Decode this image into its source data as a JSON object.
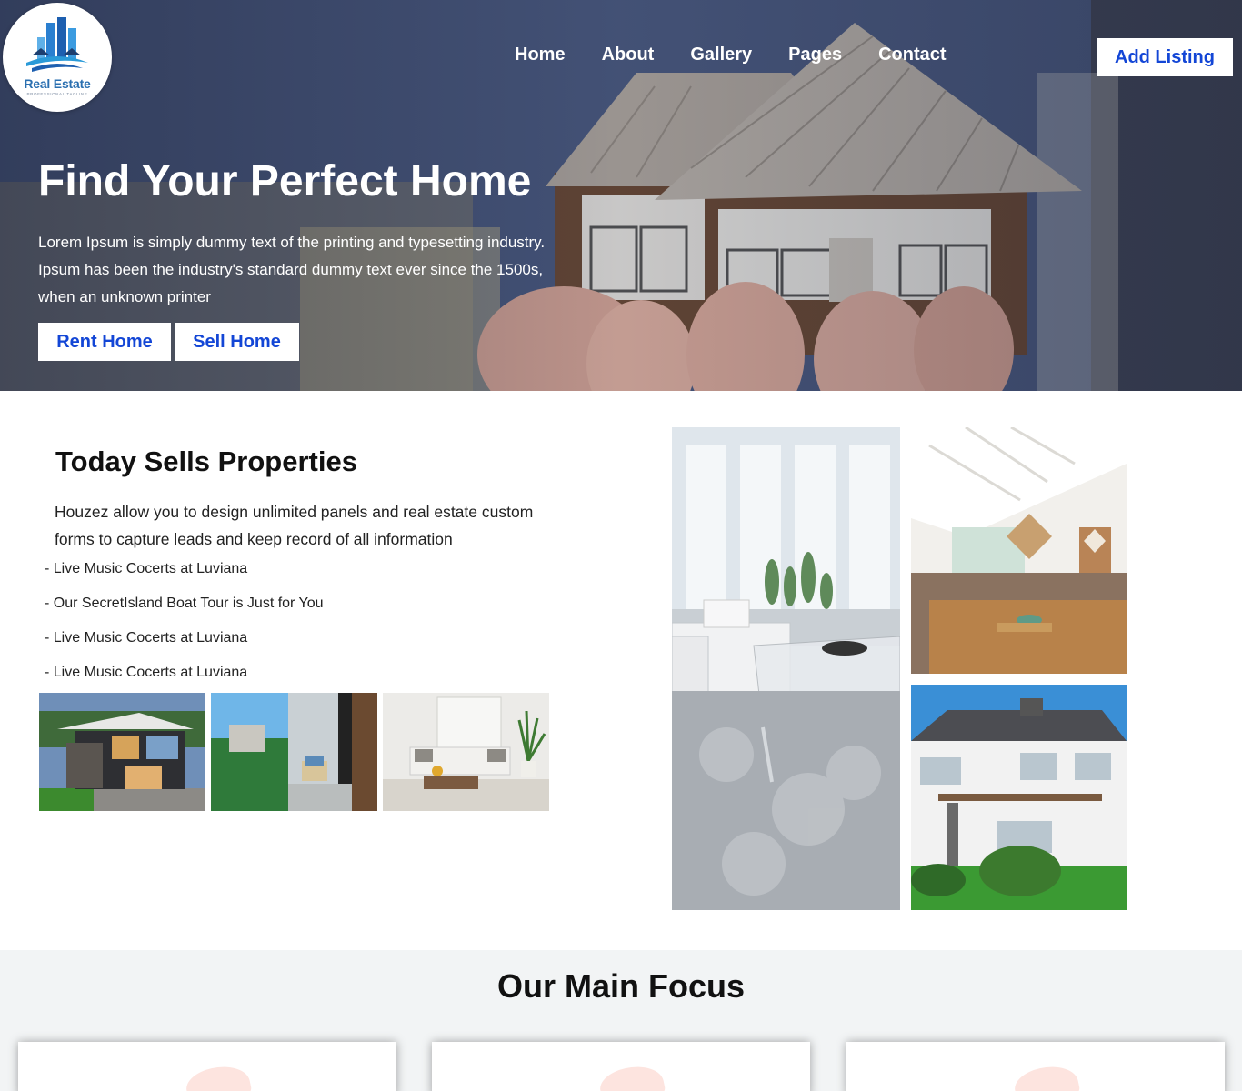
{
  "header": {
    "logo": {
      "name": "Real Estate",
      "tagline": "PROFESSIONAL TAGLINE"
    },
    "nav": [
      "Home",
      "About",
      "Gallery",
      "Pages",
      "Contact"
    ],
    "cta": "Add Listing"
  },
  "hero": {
    "title": "Find Your Perfect Home",
    "text": "Lorem Ipsum is simply dummy text of the printing and typesetting industry. Ipsum has been the industry's standard dummy text ever since the 1500s, when an unknown printer",
    "buttons": [
      "Rent Home",
      "Sell Home"
    ]
  },
  "sells": {
    "title": "Today Sells Properties",
    "description": "Houzez allow you to design unlimited panels and real estate custom forms to capture leads and keep record of all information",
    "items": [
      "- Live Music Cocerts at Luviana",
      "- Our SecretIsland Boat Tour is Just for You",
      "- Live Music Cocerts at Luviana",
      "- Live Music Cocerts at Luviana"
    ]
  },
  "focus": {
    "title": "Our Main Focus"
  },
  "colors": {
    "accent": "#1346d6",
    "focus_bg": "#f2f4f5",
    "logo_blue": "#2a6fb0"
  }
}
